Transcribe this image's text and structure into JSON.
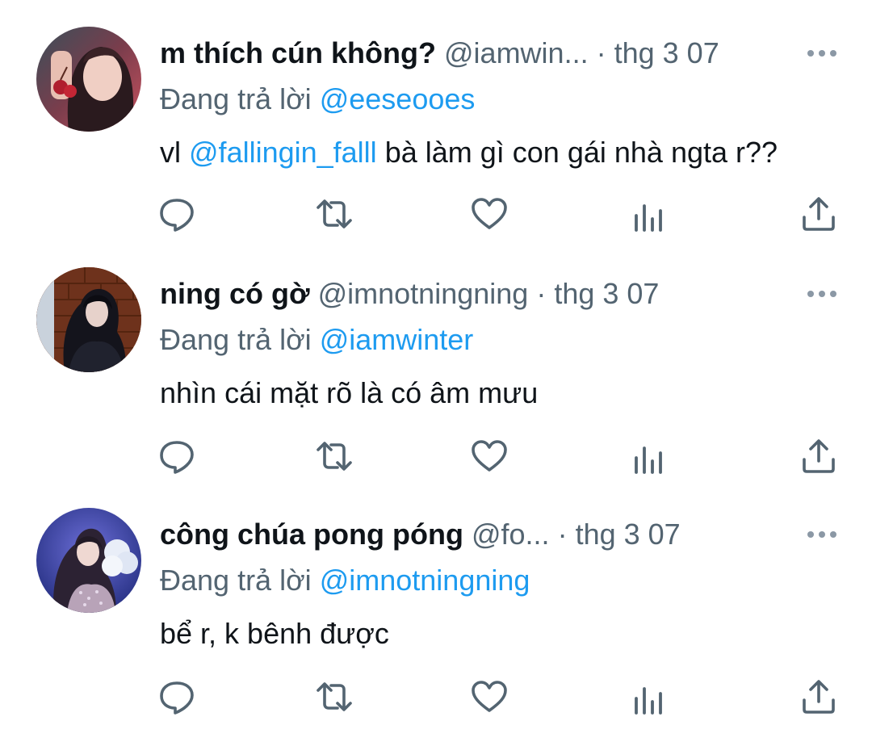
{
  "tweets": [
    {
      "display_name": "m thích cún không?",
      "handle": "@iamwin...",
      "separator": "·",
      "time": "thg 3 07",
      "reply_prefix": "Đang trả lời",
      "reply_to": "@eeseooes",
      "text_before": "vl",
      "text_mention": "@fallingin_falll",
      "text_after": "bà làm gì con gái nhà ngta r??",
      "avatar_icon": "avatar-photo-icon"
    },
    {
      "display_name": "ning có gờ",
      "handle": "@imnotningning",
      "separator": "·",
      "time": "thg 3 07",
      "reply_prefix": "Đang trả lời",
      "reply_to": "@iamwinter",
      "text_before": "nhìn cái mặt rõ là có âm mưu",
      "text_mention": "",
      "text_after": "",
      "avatar_icon": "avatar-photo-icon"
    },
    {
      "display_name": "công chúa pong póng",
      "handle": "@fo...",
      "separator": "·",
      "time": "thg 3 07",
      "reply_prefix": "Đang trả lời",
      "reply_to": "@imnotningning",
      "text_before": "bể r, k bênh được",
      "text_mention": "",
      "text_after": "",
      "avatar_icon": "avatar-photo-icon"
    }
  ],
  "actions": [
    "reply-icon",
    "retweet-icon",
    "like-icon",
    "views-icon",
    "share-icon"
  ],
  "colors": {
    "text": "#0f1419",
    "secondary": "#536471",
    "link": "#1d9bf0",
    "background": "#ffffff"
  }
}
